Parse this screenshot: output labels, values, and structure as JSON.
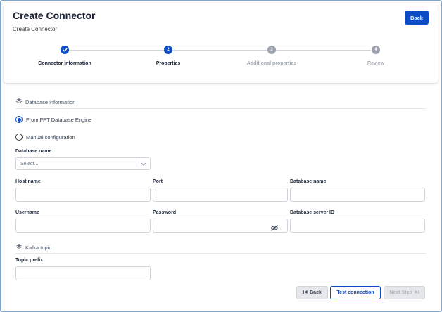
{
  "header": {
    "title": "Create Connector",
    "subtitle": "Create Connector",
    "back_label": "Back"
  },
  "stepper": {
    "steps": [
      {
        "number": "",
        "label": "Connector information",
        "state": "done"
      },
      {
        "number": "2",
        "label": "Properties",
        "state": "active"
      },
      {
        "number": "3",
        "label": "Additional properties",
        "state": "pending"
      },
      {
        "number": "4",
        "label": "Review",
        "state": "pending"
      }
    ]
  },
  "database_section": {
    "title": "Database information",
    "radio_options": [
      {
        "label": "From FPT Database Engine",
        "checked": true
      },
      {
        "label": "Manual configuration",
        "checked": false
      }
    ],
    "database_name": {
      "label": "Database name",
      "placeholder": "Select..."
    },
    "host_name": {
      "label": "Host name",
      "value": ""
    },
    "port": {
      "label": "Port",
      "value": ""
    },
    "db_name": {
      "label": "Database name",
      "value": ""
    },
    "username": {
      "label": "Username",
      "value": ""
    },
    "password": {
      "label": "Password",
      "value": ""
    },
    "server_id": {
      "label": "Database server ID",
      "value": ""
    }
  },
  "kafka_section": {
    "title": "Kafka topic",
    "topic_prefix": {
      "label": "Topic prefix",
      "value": ""
    }
  },
  "footer": {
    "back_label": "Back",
    "test_label": "Test connection",
    "next_label": "Next Step"
  },
  "colors": {
    "primary": "#0b4cc4",
    "pending_step": "#9ca3af",
    "disabled_text": "#b0b5bd"
  }
}
